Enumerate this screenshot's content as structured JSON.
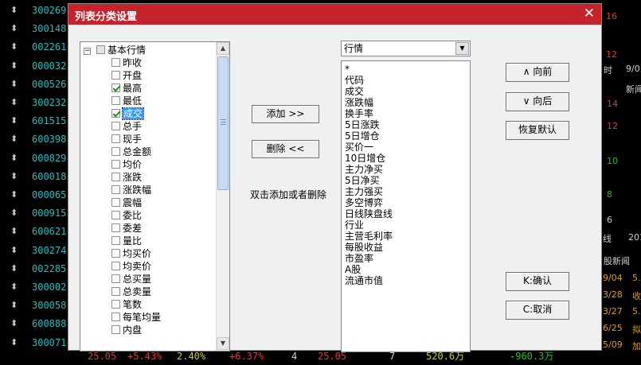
{
  "background": {
    "codes": [
      "300269",
      "300148",
      "002261",
      "000032",
      "000526",
      "300232",
      "601515",
      "600398",
      "000829",
      "600018",
      "000065",
      "000915",
      "600621",
      "300274",
      "002285",
      "300002",
      "300058",
      "600888",
      "300071"
    ],
    "bottom_row": [
      "25.05",
      "+5.43%",
      "2.40%",
      "+6.37%",
      "4",
      "25.05",
      "7",
      "520.6万",
      "-960.3万"
    ],
    "right_panel": {
      "values": [
        "16",
        "12",
        "时",
        "9/0",
        "新闻",
        "14",
        "12",
        "10",
        "8",
        "6",
        "线",
        "201",
        "股新闻"
      ],
      "dates": [
        "9/04",
        "3/28",
        "3/27",
        "6/25",
        "5/09"
      ],
      "markers": [
        "5.",
        "收",
        "5.",
        "拟",
        "加"
      ]
    }
  },
  "dialog": {
    "title": "列表分类设置",
    "close_glyph": "✕",
    "tree": {
      "root_label": "基本行情",
      "items": [
        {
          "label": "昨收",
          "checked": false
        },
        {
          "label": "开盘",
          "checked": false
        },
        {
          "label": "最高",
          "checked": true
        },
        {
          "label": "最低",
          "checked": false
        },
        {
          "label": "成交",
          "checked": true,
          "selected": true
        },
        {
          "label": "总手",
          "checked": false
        },
        {
          "label": "现手",
          "checked": false
        },
        {
          "label": "总金额",
          "checked": false
        },
        {
          "label": "均价",
          "checked": false
        },
        {
          "label": "涨跌",
          "checked": false
        },
        {
          "label": "涨跌幅",
          "checked": false
        },
        {
          "label": "震幅",
          "checked": false
        },
        {
          "label": "委比",
          "checked": false
        },
        {
          "label": "委差",
          "checked": false
        },
        {
          "label": "量比",
          "checked": false
        },
        {
          "label": "均买价",
          "checked": false
        },
        {
          "label": "均卖价",
          "checked": false
        },
        {
          "label": "总买量",
          "checked": false
        },
        {
          "label": "总卖量",
          "checked": false
        },
        {
          "label": "笔数",
          "checked": false
        },
        {
          "label": "每笔均量",
          "checked": false
        },
        {
          "label": "内盘",
          "checked": false
        }
      ]
    },
    "add_label": "添加 >>",
    "remove_label": "删除 <<",
    "hint": "双击添加或者删除",
    "category_select": "行情",
    "selected_columns": [
      "*",
      "代码",
      "成交",
      "涨跌幅",
      "换手率",
      "5日涨跌",
      "5日增仓",
      "买价一",
      "10日增仓",
      "主力净买",
      "5日净买",
      "主力强买",
      "多空博弈",
      "日线陕盘线",
      "行业",
      "主营毛利率",
      "每股收益",
      "市盈率",
      "A股",
      "流通市值"
    ],
    "up_label": "∧ 向前",
    "down_label": "∨ 向后",
    "reset_label": "恢复默认",
    "ok_label": "K:确认",
    "cancel_label": "C:取消"
  }
}
